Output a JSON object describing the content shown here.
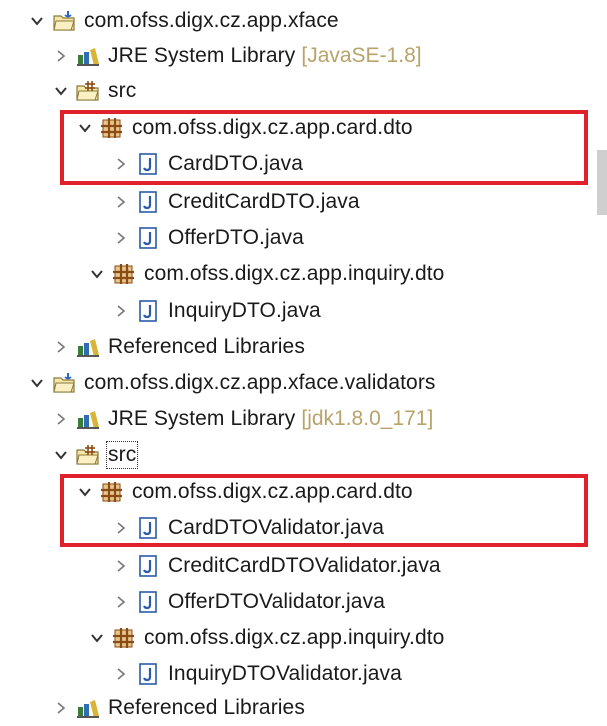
{
  "tree": [
    {
      "label": "com.ofss.digx.cz.app.xface",
      "kind": "project",
      "expanded": true
    },
    {
      "label": "JRE System Library",
      "decoration": "[JavaSE-1.8]",
      "kind": "library",
      "expanded": false
    },
    {
      "label": "src",
      "kind": "source-folder",
      "expanded": true
    },
    {
      "label": "com.ofss.digx.cz.app.card.dto",
      "kind": "package",
      "expanded": true,
      "highlighted": true
    },
    {
      "label": "CardDTO.java",
      "kind": "java-file",
      "expanded": false,
      "highlighted": true
    },
    {
      "label": "CreditCardDTO.java",
      "kind": "java-file",
      "expanded": false
    },
    {
      "label": "OfferDTO.java",
      "kind": "java-file",
      "expanded": false
    },
    {
      "label": "com.ofss.digx.cz.app.inquiry.dto",
      "kind": "package",
      "expanded": true
    },
    {
      "label": "InquiryDTO.java",
      "kind": "java-file",
      "expanded": false
    },
    {
      "label": "Referenced Libraries",
      "kind": "library",
      "expanded": false
    },
    {
      "label": "com.ofss.digx.cz.app.xface.validators",
      "kind": "project",
      "expanded": true
    },
    {
      "label": "JRE System Library",
      "decoration": "[jdk1.8.0_171]",
      "kind": "library",
      "expanded": false
    },
    {
      "label": "src",
      "kind": "source-folder",
      "expanded": true
    },
    {
      "label": "com.ofss.digx.cz.app.card.dto",
      "kind": "package",
      "expanded": true,
      "highlighted": true
    },
    {
      "label": "CardDTOValidator.java",
      "kind": "java-file",
      "expanded": false,
      "highlighted": true
    },
    {
      "label": "CreditCardDTOValidator.java",
      "kind": "java-file",
      "expanded": false
    },
    {
      "label": "OfferDTOValidator.java",
      "kind": "java-file",
      "expanded": false
    },
    {
      "label": "com.ofss.digx.cz.app.inquiry.dto",
      "kind": "package",
      "expanded": true
    },
    {
      "label": "InquiryDTOValidator.java",
      "kind": "java-file",
      "expanded": false
    },
    {
      "label": "Referenced Libraries",
      "kind": "library",
      "expanded": false
    }
  ],
  "colors": {
    "highlight_border": "#e0202a",
    "decoration_text": "#b8a36a"
  }
}
